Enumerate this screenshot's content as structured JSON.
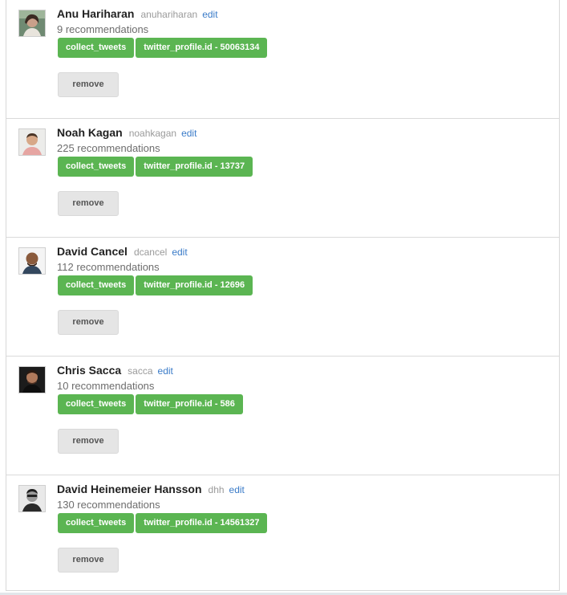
{
  "users": [
    {
      "name": "Anu Hariharan",
      "handle": "anuhariharan",
      "edit_label": "edit",
      "recommendations": "9 recommendations",
      "tags": [
        "collect_tweets",
        "twitter_profile.id - 50063134"
      ],
      "remove_label": "remove"
    },
    {
      "name": "Noah Kagan",
      "handle": "noahkagan",
      "edit_label": "edit",
      "recommendations": "225 recommendations",
      "tags": [
        "collect_tweets",
        "twitter_profile.id - 13737"
      ],
      "remove_label": "remove"
    },
    {
      "name": "David Cancel",
      "handle": "dcancel",
      "edit_label": "edit",
      "recommendations": "112 recommendations",
      "tags": [
        "collect_tweets",
        "twitter_profile.id - 12696"
      ],
      "remove_label": "remove"
    },
    {
      "name": "Chris Sacca",
      "handle": "sacca",
      "edit_label": "edit",
      "recommendations": "10 recommendations",
      "tags": [
        "collect_tweets",
        "twitter_profile.id - 586"
      ],
      "remove_label": "remove"
    },
    {
      "name": "David Heinemeier Hansson",
      "handle": "dhh",
      "edit_label": "edit",
      "recommendations": "130 recommendations",
      "tags": [
        "collect_tweets",
        "twitter_profile.id - 14561327"
      ],
      "remove_label": "remove"
    }
  ],
  "colors": {
    "tag_green": "#5bb552",
    "link_blue": "#3a7bc8",
    "button_gray": "#e5e5e5"
  }
}
